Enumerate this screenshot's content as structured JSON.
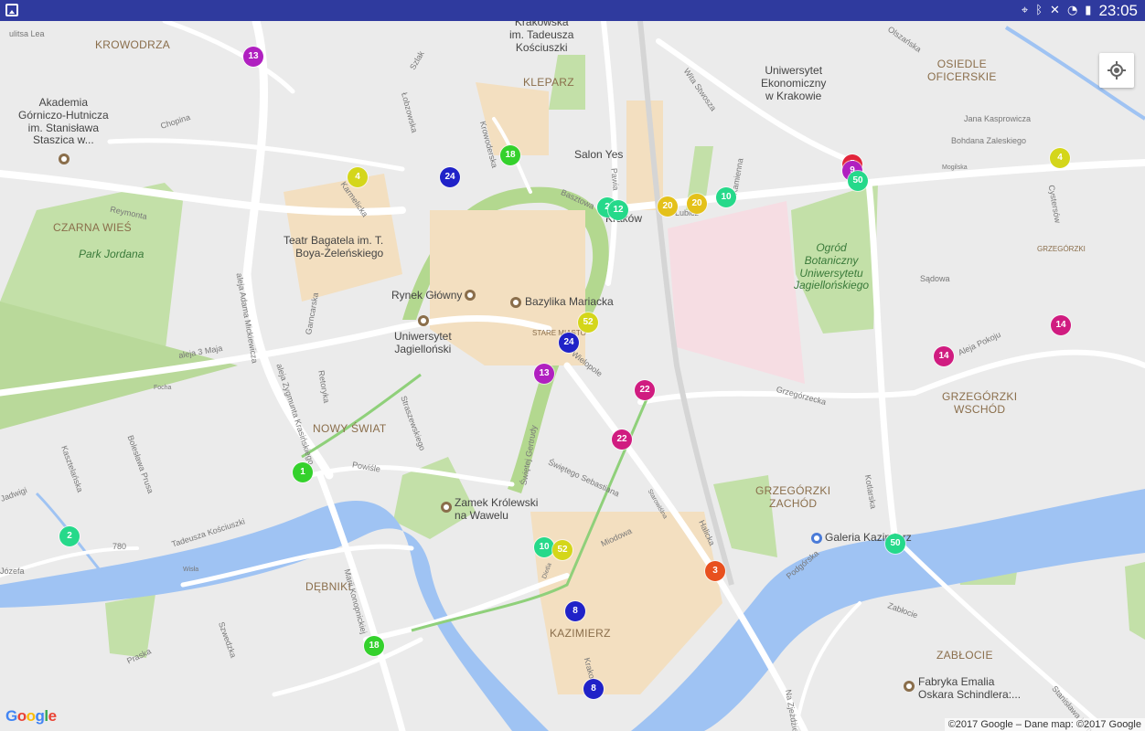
{
  "status_bar": {
    "time": "23:05",
    "icons": [
      "location-icon",
      "bluetooth-icon",
      "mute-icon",
      "wifi-icon",
      "battery-icon"
    ]
  },
  "colors": {
    "green": "#34d12c",
    "teal": "#26d98a",
    "yellow": "#d4d61a",
    "mustard": "#e4c11a",
    "purple": "#b020c0",
    "magenta": "#d01c80",
    "blue": "#2022c8",
    "orange": "#e8501e",
    "red": "#e2243a"
  },
  "labels": {
    "d_krowodrza": "KROWODRZA",
    "d_kleparz": "KLEPARZ",
    "d_osiedle": "OSIEDLE\nOFICERSKIE",
    "d_czarna": "CZARNA WIEŚ",
    "d_nowy": "NOWY ŚWIAT",
    "d_dębniki": "DĘBNIKI",
    "d_kazimierz": "KAZIMIERZ",
    "d_grz_wschod": "GRZEGÓRZKI\nWSCHÓD",
    "d_grz_zachod": "GRZEGÓRZKI\nZACHÓD",
    "d_zablocie": "ZABŁOCIE",
    "d_grz_small": "GRZEGÓRZKI",
    "d_stare": "STARE MIASTO",
    "p_akademia": "Akademia\nGórniczo-Hutnicza\nim. Stanisława\nStaszica w...",
    "p_krakowska": "Krakowska\nim. Tadeusza\nKościuszki",
    "p_uek": "Uniwersytet\nEkonomiczny\nw Krakowie",
    "p_salon": "Salon Yes",
    "p_krakow": "Kraków",
    "p_bagatela": "Teatr Bagatela im. T.\nBoya-Żeleńskiego",
    "p_rynek": "Rynek Główny",
    "p_mariacka": "Bazylika Mariacka",
    "p_uj": "Uniwersytet\nJagielloński",
    "p_wawel": "Zamek Królewski\nna Wawelu",
    "p_galeria": "Galeria Kazimierz",
    "p_emalia": "Fabryka Emalia\nOskara Schindlera:...",
    "park_jordana": "Park Jordana",
    "park_ogrod": "Ogród\nBotaniczny\nUniwersytetu\nJagiellońskiego",
    "s_lea": "ulitsa Lea",
    "s_chopina": "Chopina",
    "s_reymonta": "Reymonta",
    "s_szlak": "Szlak",
    "s_lobzowska": "Łobzowska",
    "s_krowoderska": "Krowoderska",
    "s_karmelicka": "Karmelicka",
    "s_basztowa": "Basztowa",
    "s_pawia": "Pawia",
    "s_lubicz": "Lubicz",
    "s_wita": "Wita Stwosza",
    "s_kamienna": "Kamienna",
    "s_olszanska": "Olszańska",
    "s_kasprowicza": "Jana Kasprowicza",
    "s_zaleskiego": "Bohdana Zaleskiego",
    "s_mogilska": "Mogilska",
    "s_cystersow": "Cystersów",
    "s_sadowa": "Sądowa",
    "s_pokoju": "Aleja Pokoju",
    "s_grzegorzecka": "Grzegórzecka",
    "s_wielopole": "Wielopole",
    "s_3maja": "aleja 3 Maja",
    "s_focha": "Focha",
    "s_garncarska": "Garncarska",
    "s_retoryka": "Retoryka",
    "s_straszewskiego": "Straszewskiego",
    "s_mickiewicza": "aleja Adama Mickiewicza",
    "s_krasinskiego": "aleja Zygmunta Krasińskiego",
    "s_powisle": "Powiśle",
    "s_gertrudy": "Świętej Gertrudy",
    "s_sebastiana": "Świętego Sebastiana",
    "s_starowislna": "Starowiślna",
    "s_miodowa": "Miodowa",
    "s_dietla": "Dietla",
    "s_halicka": "Halicka",
    "s_kotlarska": "Kotlarska",
    "s_podgorska": "Podgórska",
    "s_zablocie": "Zabłocie",
    "s_kosciuszki": "Tadeusza Kościuszki",
    "s_780": "780",
    "s_kaszelanska": "Kasztelańska",
    "s_prusa": "Bolesława Prusa",
    "s_jadwigi": "Jadwigi",
    "s_jozefa": "Józefa",
    "s_wisla": "Wisła",
    "s_konopnickiej": "Marii Konopnickiej",
    "s_praska": "Praska",
    "s_szwedzka": "Szwedzka",
    "s_krakowska": "Krakowska",
    "s_klimeckiego": "Stanisława Klimeckiego",
    "s_zieleniecka": "Na Zjeżdżie"
  },
  "markers": [
    {
      "num": "13",
      "color": "#b020c0"
    },
    {
      "num": "4",
      "color": "#d4d61a"
    },
    {
      "num": "24",
      "color": "#2022c8"
    },
    {
      "num": "18",
      "color": "#34d12c"
    },
    {
      "num": "2",
      "color": "#26d98a"
    },
    {
      "num": "12",
      "color": "#26d98a"
    },
    {
      "num": "20",
      "color": "#e4c11a"
    },
    {
      "num": "20",
      "color": "#e4c11a"
    },
    {
      "num": "10",
      "color": "#26d98a"
    },
    {
      "num": "5",
      "color": "#e2243a"
    },
    {
      "num": "9",
      "color": "#b020c0"
    },
    {
      "num": "50",
      "color": "#26d98a"
    },
    {
      "num": "4",
      "color": "#d4d61a"
    },
    {
      "num": "14",
      "color": "#d01c80"
    },
    {
      "num": "14",
      "color": "#d01c80"
    },
    {
      "num": "52",
      "color": "#d4d61a"
    },
    {
      "num": "24",
      "color": "#2022c8"
    },
    {
      "num": "13",
      "color": "#b020c0"
    },
    {
      "num": "22",
      "color": "#d01c80"
    },
    {
      "num": "22",
      "color": "#d01c80"
    },
    {
      "num": "1",
      "color": "#34d12c"
    },
    {
      "num": "2",
      "color": "#26d98a"
    },
    {
      "num": "10",
      "color": "#26d98a"
    },
    {
      "num": "52",
      "color": "#d4d61a"
    },
    {
      "num": "3",
      "color": "#e8501e"
    },
    {
      "num": "50",
      "color": "#26d98a"
    },
    {
      "num": "8",
      "color": "#2022c8"
    },
    {
      "num": "18",
      "color": "#34d12c"
    },
    {
      "num": "8",
      "color": "#2022c8"
    }
  ],
  "google_logo": "Google",
  "attribution": "©2017 Google – Dane map: ©2017 Google"
}
